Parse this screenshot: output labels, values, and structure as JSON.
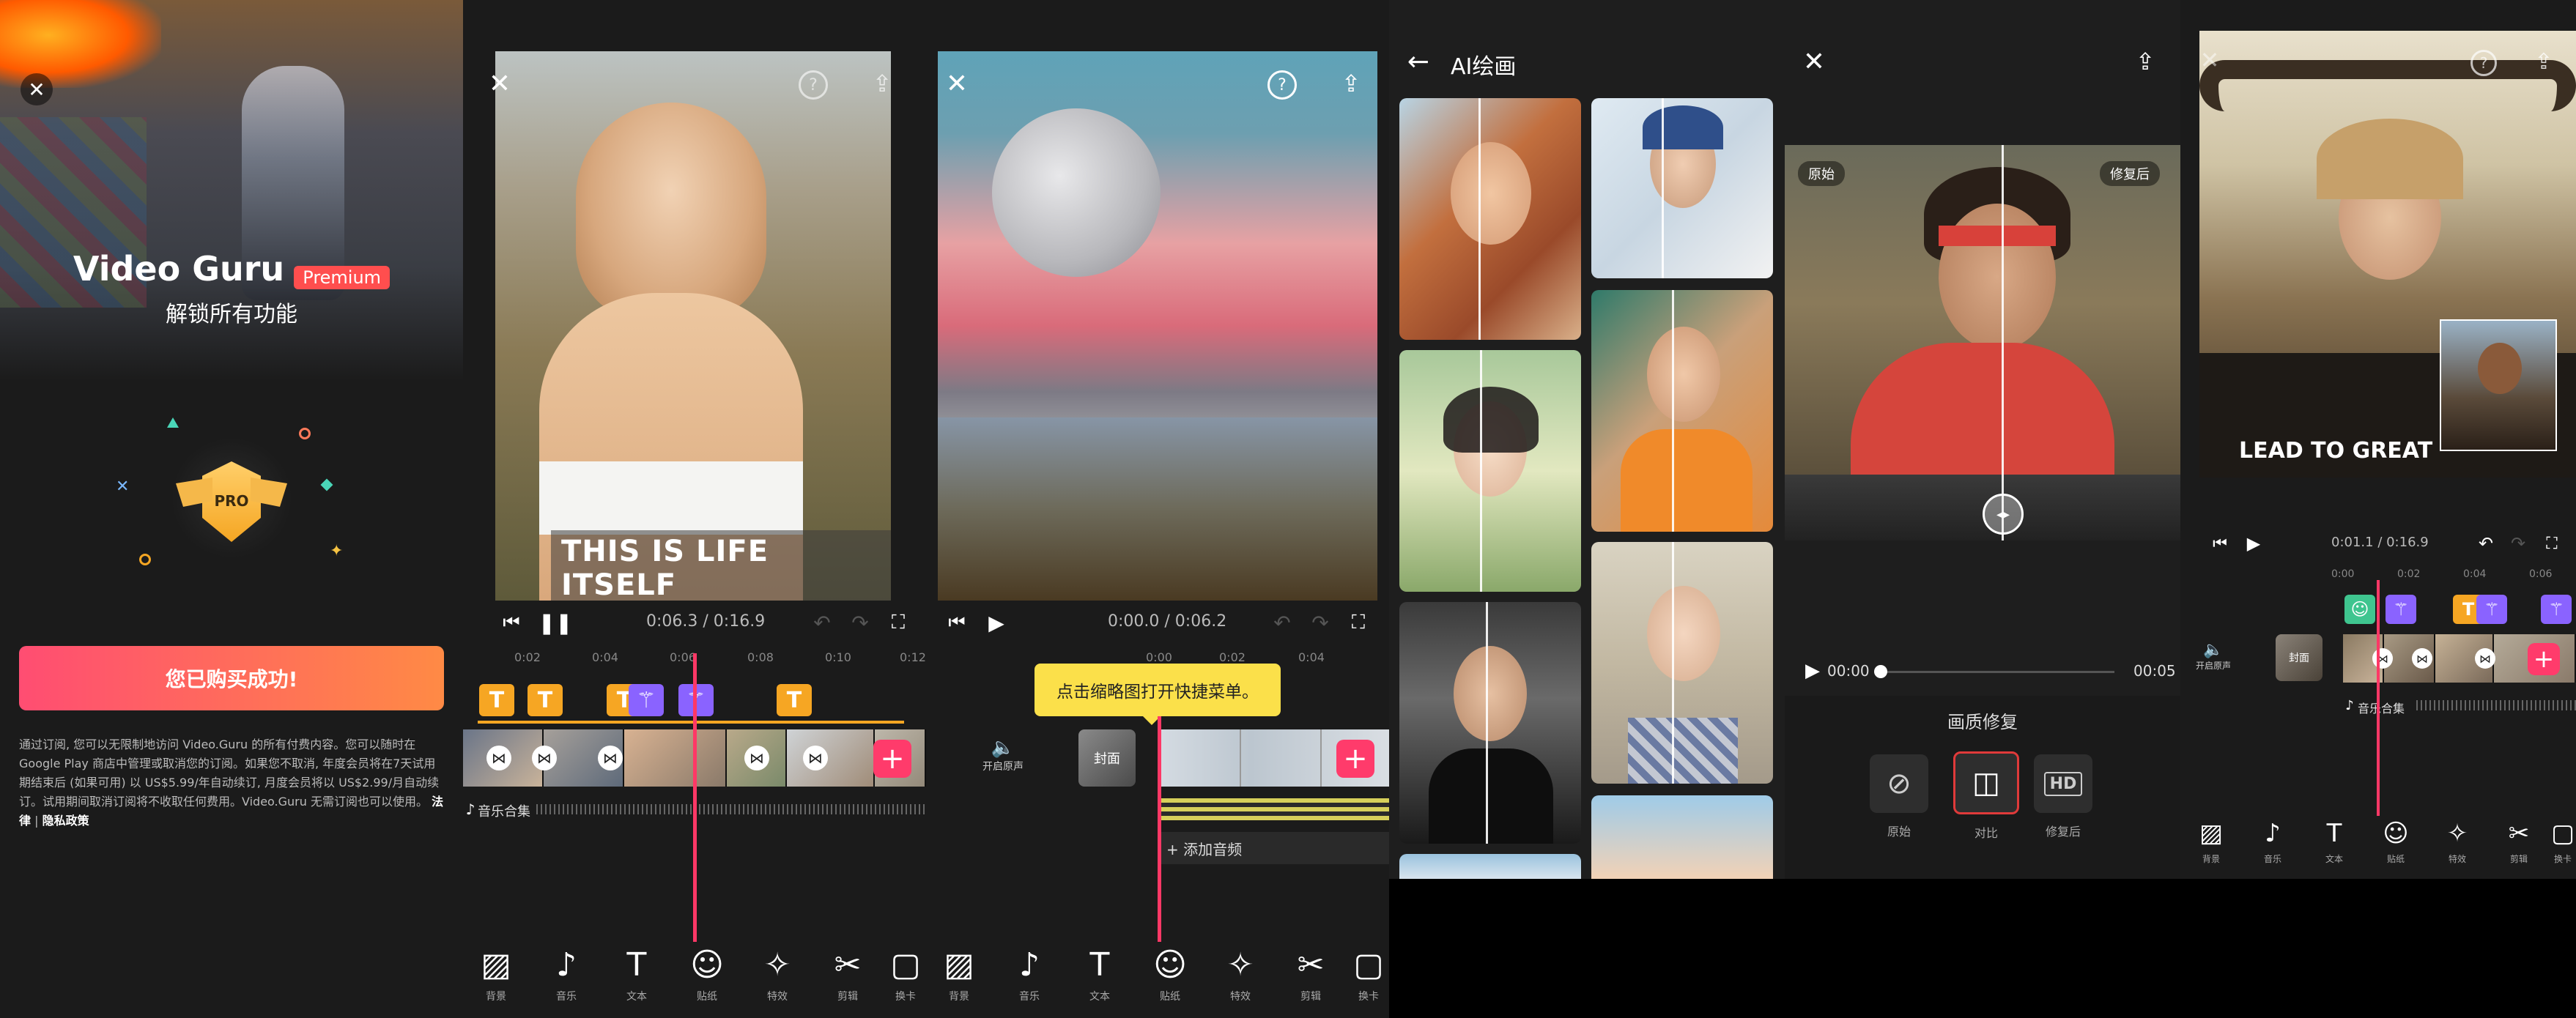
{
  "p1": {
    "brand": "Video Guru",
    "badge": "Premium",
    "tagline": "解锁所有功能",
    "pro_label": "PRO",
    "purchase_button": "您已购买成功!",
    "legal_text": "通过订阅, 您可以无限制地访问 Video.Guru 的所有付费内容。您可以随时在 Google Play 商店中管理或取消您的订阅。如果您不取消, 年度会员将在7天试用期结束后 (如果可用) 以 US$5.99/年自动续订, 月度会员将以 US$2.99/月自动续订。试用期间取消订阅将不收取任何费用。Video.Guru 无需订阅也可以使用。",
    "legal_link": "法律",
    "privacy_link": "隐私政策",
    "colors": {
      "button_start": "#ff4d72",
      "button_end": "#ff8a45",
      "badge": "#ff4e4e"
    }
  },
  "p2": {
    "caption": "THIS IS LIFE ITSELF",
    "time": "0:06.3 / 0:16.9",
    "ticks": [
      "0:02",
      "0:04",
      "0:06",
      "0:08",
      "0:10",
      "0:12"
    ],
    "music": "音乐合集",
    "tools": [
      {
        "icon": "background-icon",
        "glyph": "▨",
        "label": "背景"
      },
      {
        "icon": "music-icon",
        "glyph": "♪",
        "label": "音乐"
      },
      {
        "icon": "text-icon",
        "glyph": "T",
        "label": "文本"
      },
      {
        "icon": "sticker-icon",
        "glyph": "☺",
        "label": "贴纸"
      },
      {
        "icon": "effects-icon",
        "glyph": "✧",
        "label": "特效"
      },
      {
        "icon": "cut-icon",
        "glyph": "✂",
        "label": "剪辑"
      },
      {
        "icon": "replace-icon",
        "glyph": "▢",
        "label": "换卡"
      }
    ]
  },
  "p3": {
    "time": "0:00.0 / 0:06.2",
    "ticks": [
      "0:00",
      "0:02",
      "0:04"
    ],
    "tooltip": "点击缩略图打开快捷菜单。",
    "sound_label": "开启原声",
    "cover_label": "封面",
    "add_audio": "+ 添加音频",
    "tools": [
      {
        "icon": "background-icon",
        "glyph": "▨",
        "label": "背景"
      },
      {
        "icon": "music-icon",
        "glyph": "♪",
        "label": "音乐"
      },
      {
        "icon": "text-icon",
        "glyph": "T",
        "label": "文本"
      },
      {
        "icon": "sticker-icon",
        "glyph": "☺",
        "label": "贴纸"
      },
      {
        "icon": "effects-icon",
        "glyph": "✧",
        "label": "特效"
      },
      {
        "icon": "cut-icon",
        "glyph": "✂",
        "label": "剪辑"
      },
      {
        "icon": "replace-icon",
        "glyph": "▢",
        "label": "换卡"
      }
    ]
  },
  "p4": {
    "title": "AI绘画"
  },
  "p5": {
    "before_label": "原始",
    "after_label": "修复后",
    "time_start": "00:00",
    "time_end": "00:05",
    "section_title": "画质修复",
    "options": [
      {
        "icon": "no-icon",
        "glyph": "⊘",
        "label": "原始"
      },
      {
        "icon": "compare-icon",
        "glyph": "◫",
        "label": "对比"
      },
      {
        "icon": "hd-icon",
        "glyph": "HD",
        "label": "修复后"
      }
    ]
  },
  "p6": {
    "caption": "LEAD TO GREAT",
    "time": "0:01.1 / 0:16.9",
    "ticks": [
      "0:00",
      "0:02",
      "0:04",
      "0:06"
    ],
    "sound_label": "开启原声",
    "cover_label": "封面",
    "music": "音乐合集",
    "tools": [
      {
        "icon": "background-icon",
        "glyph": "▨",
        "label": "背景"
      },
      {
        "icon": "music-icon",
        "glyph": "♪",
        "label": "音乐"
      },
      {
        "icon": "text-icon",
        "glyph": "T",
        "label": "文本"
      },
      {
        "icon": "sticker-icon",
        "glyph": "☺",
        "label": "贴纸"
      },
      {
        "icon": "effects-icon",
        "glyph": "✧",
        "label": "特效"
      },
      {
        "icon": "cut-icon",
        "glyph": "✂",
        "label": "剪辑"
      },
      {
        "icon": "replace-icon",
        "glyph": "▢",
        "label": "换卡"
      }
    ]
  }
}
